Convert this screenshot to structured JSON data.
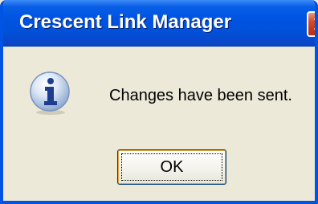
{
  "window": {
    "title": "Crescent Link Manager",
    "close_icon": "close-x-icon",
    "colors": {
      "titlebar": "#0054e3",
      "close_button": "#d6502f",
      "body": "#ece9d8"
    }
  },
  "dialog": {
    "icon": "info-icon",
    "message": "Changes have been sent.",
    "ok_label": "OK"
  }
}
